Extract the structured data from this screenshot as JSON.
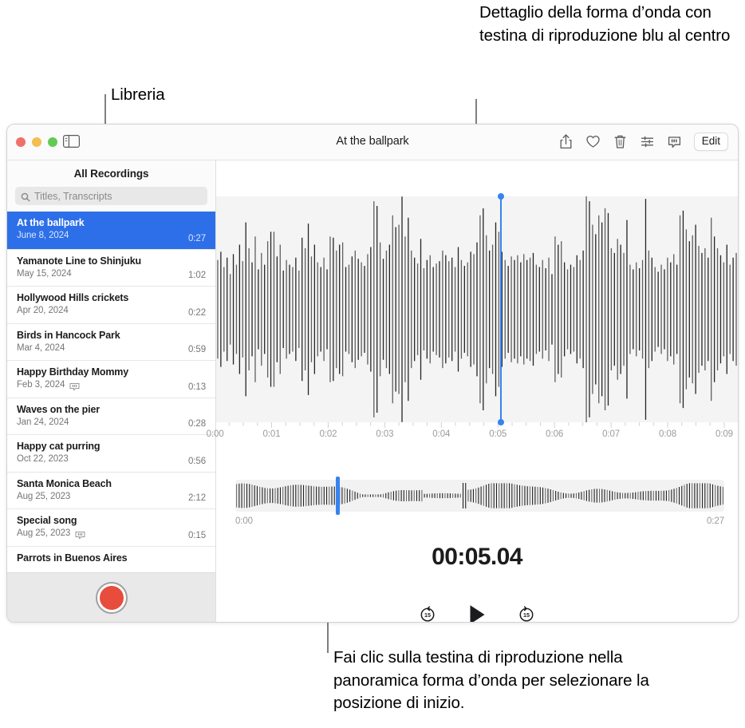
{
  "annotations": {
    "top": "Dettaglio della forma d’onda con testina di riproduzione blu al centro",
    "left": "Libreria",
    "bottom": "Fai clic sulla testina di riproduzione nella panoramica forma d’onda per selezionare la posizione di inizio."
  },
  "window": {
    "title": "At the ballpark",
    "toolbar": {
      "edit_label": "Edit",
      "icons": [
        "share-icon",
        "heart-icon",
        "trash-icon",
        "enhance-icon",
        "transcript-icon"
      ]
    },
    "sidebar_toggle_icon": "sidebar-toggle-icon",
    "traffic_lights": {
      "close_color": "#f0706a",
      "minimize_color": "#f4bf51",
      "zoom_color": "#63cb53"
    }
  },
  "sidebar": {
    "header": "All Recordings",
    "search": {
      "placeholder": "Titles, Transcripts",
      "value": "",
      "icon": "search-icon"
    },
    "recordings": [
      {
        "title": "At the ballpark",
        "date": "June 8, 2024",
        "duration": "0:27",
        "transcript": false,
        "selected": true
      },
      {
        "title": "Yamanote Line to Shinjuku",
        "date": "May 15, 2024",
        "duration": "1:02",
        "transcript": false,
        "selected": false
      },
      {
        "title": "Hollywood Hills crickets",
        "date": "Apr 20, 2024",
        "duration": "0:22",
        "transcript": false,
        "selected": false
      },
      {
        "title": "Birds in Hancock Park",
        "date": "Mar 4, 2024",
        "duration": "0:59",
        "transcript": false,
        "selected": false
      },
      {
        "title": "Happy Birthday Mommy",
        "date": "Feb 3, 2024",
        "duration": "0:13",
        "transcript": true,
        "selected": false
      },
      {
        "title": "Waves on the pier",
        "date": "Jan 24, 2024",
        "duration": "0:28",
        "transcript": false,
        "selected": false
      },
      {
        "title": "Happy cat purring",
        "date": "Oct 22, 2023",
        "duration": "0:56",
        "transcript": false,
        "selected": false
      },
      {
        "title": "Santa Monica Beach",
        "date": "Aug 25, 2023",
        "duration": "2:12",
        "transcript": false,
        "selected": false
      },
      {
        "title": "Special song",
        "date": "Aug 25, 2023",
        "duration": "0:15",
        "transcript": true,
        "selected": false
      },
      {
        "title": "Parrots in Buenos Aires",
        "date": "",
        "duration": "",
        "transcript": false,
        "selected": false
      }
    ],
    "record_button": {
      "name": "record-button",
      "color": "#e74c3c"
    },
    "selection_color": "#2d6fe8"
  },
  "player": {
    "time_display": "00:05.04",
    "playhead_color": "#3782f0",
    "detail_playhead_seconds": 5.04,
    "ruler_labels": [
      "0:00",
      "0:01",
      "0:02",
      "0:03",
      "0:04",
      "0:05",
      "0:06",
      "0:07",
      "0:08",
      "0:09"
    ],
    "overview": {
      "start_label": "0:00",
      "end_label": "0:27",
      "playhead_fraction": 0.205
    },
    "transport": {
      "skip_back_label": "15",
      "skip_forward_label": "15",
      "play_icon": "play-icon",
      "skip_back_icon": "skip-back-15-icon",
      "skip_forward_icon": "skip-forward-15-icon"
    }
  },
  "waveform": {
    "detail_amplitudes": [
      0.42,
      0.49,
      0.36,
      0.44,
      0.3,
      0.47,
      0.38,
      0.55,
      0.41,
      0.74,
      0.52,
      0.4,
      0.62,
      0.34,
      0.48,
      0.38,
      0.58,
      0.66,
      0.66,
      0.45,
      0.55,
      0.33,
      0.42,
      0.38,
      0.36,
      0.44,
      0.33,
      0.61,
      0.52,
      0.73,
      0.45,
      0.55,
      0.4,
      0.36,
      0.44,
      0.34,
      0.62,
      0.61,
      0.5,
      0.55,
      0.57,
      0.36,
      0.38,
      0.45,
      0.5,
      0.43,
      0.4,
      0.37,
      0.47,
      0.53,
      0.92,
      0.88,
      0.57,
      0.43,
      0.5,
      0.55,
      0.8,
      0.7,
      0.72,
      0.96,
      0.62,
      0.78,
      0.5,
      0.44,
      0.39,
      0.6,
      0.35,
      0.42,
      0.46,
      0.36,
      0.39,
      0.41,
      0.5,
      0.46,
      0.41,
      0.44,
      0.36,
      0.53,
      0.42,
      0.37,
      0.4,
      0.49,
      0.47,
      0.57,
      0.8,
      0.86,
      0.63,
      0.5,
      0.55,
      0.74,
      0.66,
      0.49,
      0.42,
      0.37,
      0.45,
      0.42,
      0.46,
      0.4,
      0.47,
      0.42,
      0.44,
      0.48,
      0.38,
      0.36,
      0.42,
      0.35,
      0.44,
      0.3,
      0.62,
      0.55,
      0.58,
      0.4,
      0.34,
      0.38,
      0.36,
      0.46,
      0.42,
      0.5,
      0.98,
      0.92,
      0.72,
      0.64,
      0.8,
      0.74,
      0.86,
      0.82,
      0.52,
      0.48,
      0.6,
      0.55,
      0.48,
      0.76,
      0.38,
      0.34,
      0.4,
      0.35,
      0.42,
      0.94,
      0.5,
      0.44,
      0.36,
      0.32,
      0.38,
      0.34,
      0.44,
      0.4,
      0.47,
      0.38,
      0.8,
      0.84,
      0.68,
      0.58,
      0.63,
      0.72,
      0.54,
      0.48,
      0.52,
      0.44,
      0.78,
      0.62,
      0.52,
      0.46,
      0.4,
      0.55,
      0.38,
      0.44,
      0.48
    ],
    "overview_density": 190
  }
}
